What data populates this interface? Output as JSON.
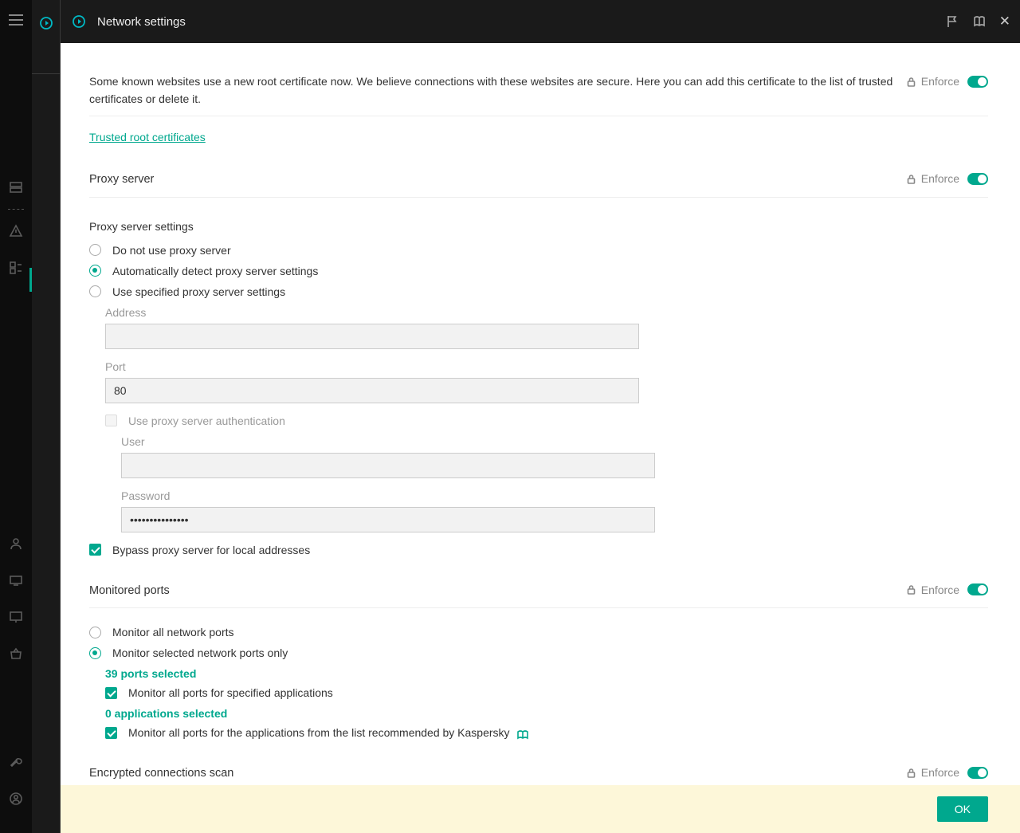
{
  "header": {
    "title": "Network settings"
  },
  "certs": {
    "desc": "Some known websites use a new root certificate now. We believe connections with these websites are secure. Here you can add this certificate to the list of trusted certificates or delete it.",
    "link": "Trusted root certificates"
  },
  "enforce_label": "Enforce",
  "proxy": {
    "title": "Proxy server",
    "settings_label": "Proxy server settings",
    "opt_none": "Do not use proxy server",
    "opt_auto": "Automatically detect proxy server settings",
    "opt_spec": "Use specified proxy server settings",
    "address_label": "Address",
    "address_value": "",
    "port_label": "Port",
    "port_value": "80",
    "auth_label": "Use proxy server authentication",
    "user_label": "User",
    "user_value": "",
    "pass_label": "Password",
    "pass_value": "•••••••••••••••",
    "bypass_label": "Bypass proxy server for local addresses"
  },
  "ports": {
    "title": "Monitored ports",
    "opt_all": "Monitor all network ports",
    "opt_sel": "Monitor selected network ports only",
    "ports_selected": "39 ports selected",
    "chk_apps": "Monitor all ports for specified applications",
    "apps_selected": "0 applications selected",
    "chk_kasp": "Monitor all ports for the applications from the list recommended by Kaspersky"
  },
  "enc": {
    "title": "Encrypted connections scan"
  },
  "footer": {
    "ok": "OK"
  }
}
